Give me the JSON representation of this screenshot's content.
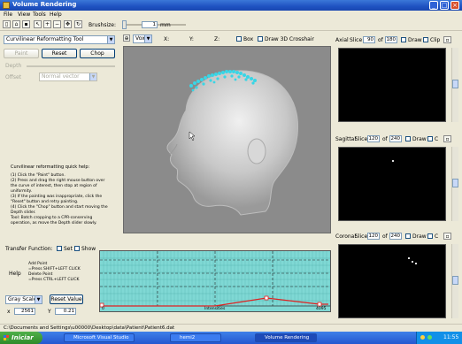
{
  "window": {
    "title": "Volume Rendering",
    "controls": {
      "minimize": "_",
      "maximize": "□",
      "close": "×"
    }
  },
  "menu": [
    "File",
    "View",
    "Tools",
    "Help"
  ],
  "toolbar": {
    "brush_label": "Brushsize:",
    "brush_value": "1",
    "brush_unit": "mm"
  },
  "viewtoolbar": {
    "voxel_prefix": "Vox",
    "x_label": "X:",
    "y_label": "Y:",
    "z_label": "Z:",
    "box_label": "Box",
    "crosshair_label": "Draw 3D Crosshair"
  },
  "left": {
    "mode_select": "Curvilinear Reformatting Tool",
    "buttons": {
      "paint": "Paint",
      "reset": "Reset",
      "chop": "Chop"
    },
    "depth_label": "Depth",
    "offset_label": "Offset",
    "offset_select": "Normal vector",
    "quick_help_title": "Curvilinear reformatting quick help:",
    "quick_help_lines": [
      "(1) Click the \"Paint\" button.",
      "(2) Press and drag the right mouse button over",
      "the curve of interest, then stop at region of",
      "uniformity.",
      "(3) If the painting was inappropriate, click the",
      "\"Reset\" button and retry painting.",
      "(4) Click the \"Chop\" button and start moving the",
      "Depth slider.",
      "Tool: Batch cropping to a CPR-conserving",
      "operation, as move the Depth slider slowly."
    ]
  },
  "transfer": {
    "label": "Transfer Function:",
    "opt1": "Set",
    "opt2": "Show",
    "help_label": "Help",
    "help_lines": [
      "Add Point",
      "=Press SHIFT+LEFT CLICK",
      "Delete Point",
      "=Press CTRL+LEFT CLICK"
    ],
    "colormap_select": "Gray Scale",
    "reset_button": "Reset Value",
    "x_label": "x",
    "x_value": "2561",
    "y_label": "Y",
    "y_value": "0.21",
    "axis_left": "0",
    "axis_mid": "Intensities",
    "axis_right": "4095"
  },
  "axial": {
    "title": "Axial",
    "slice_label": "Slice",
    "slice_value": "90",
    "of_label": "of",
    "total": "180",
    "draw_label": "Draw",
    "clip_label": "Clip"
  },
  "sagittal": {
    "title": "Sagittal",
    "slice_label": "Slice",
    "slice_value": "120",
    "of_label": "of",
    "total": "240",
    "draw_label": "Draw",
    "clip_label": "C"
  },
  "coronal": {
    "title": "Coronal",
    "slice_label": "Slice",
    "slice_value": "120",
    "of_label": "of",
    "total": "240",
    "draw_label": "Draw",
    "clip_label": "C"
  },
  "status": "C:\\Documents and Settings\\u00000\\Desktop\\data\\Patient\\Patient6.dat",
  "taskbar": {
    "start_label": "Iniciar",
    "tasks": [
      "Microsoft Visual Studio",
      "hemi2",
      "Volume Rendering"
    ],
    "clock": "11:55"
  }
}
